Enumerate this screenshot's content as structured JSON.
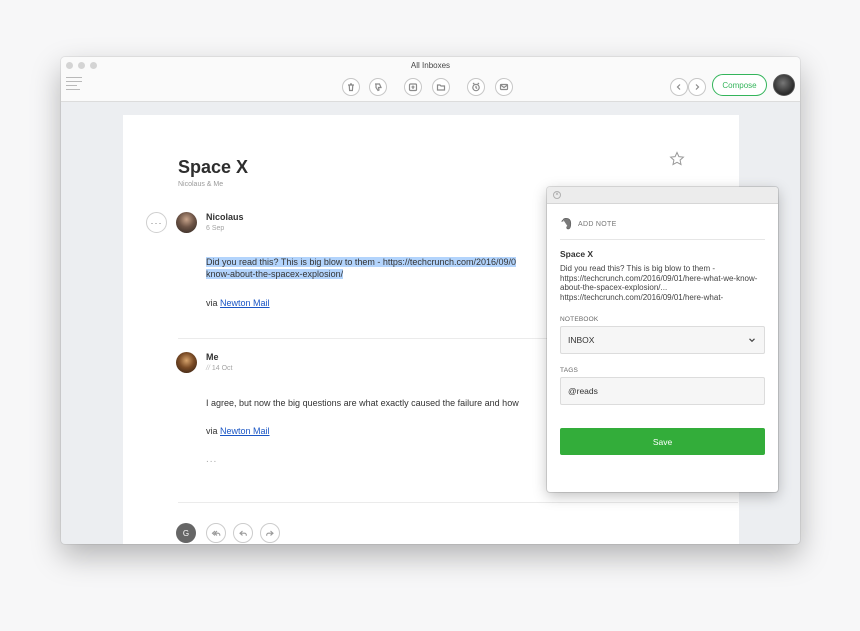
{
  "window": {
    "title": "All Inboxes"
  },
  "toolbar": {
    "icons": [
      "trash-icon",
      "thumbs-down-icon",
      "move-to-icon",
      "folder-icon",
      "snooze-icon",
      "mail-icon"
    ],
    "compose_label": "Compose"
  },
  "thread": {
    "subject": "Space X",
    "participants": "Nicolaus & Me",
    "messages": [
      {
        "sender": "Nicolaus",
        "date": "6 Sep",
        "line1": "Did you read this? This is big blow to them - https://techcrunch.com/2016/09/0",
        "line2": "know-about-the-spacex-explosion/",
        "via_prefix": "via ",
        "via_link": "Newton Mail"
      },
      {
        "sender": "Me",
        "date": "14 Oct",
        "line1": "I agree, but now the big questions are what exactly caused the failure and how",
        "via_prefix": "via ",
        "via_link": "Newton Mail",
        "ellipsis": "..."
      }
    ],
    "reply_avatar_initial": "G"
  },
  "note_panel": {
    "header": "ADD NOTE",
    "title": "Space X",
    "body": "Did you read this? This is big blow to them - https://techcrunch.com/2016/09/01/here-what-we-know-about-the-spacex-explosion/... https://techcrunch.com/2016/09/01/here-what-",
    "notebook_label": "NOTEBOOK",
    "notebook_value": "INBOX",
    "tags_label": "TAGS",
    "tags_value": "@reads",
    "save_label": "Save"
  },
  "colors": {
    "accent_green": "#33ad3a",
    "compose_green": "#34b55b",
    "link_blue": "#1a56c5",
    "selection": "#b3d4fc"
  }
}
